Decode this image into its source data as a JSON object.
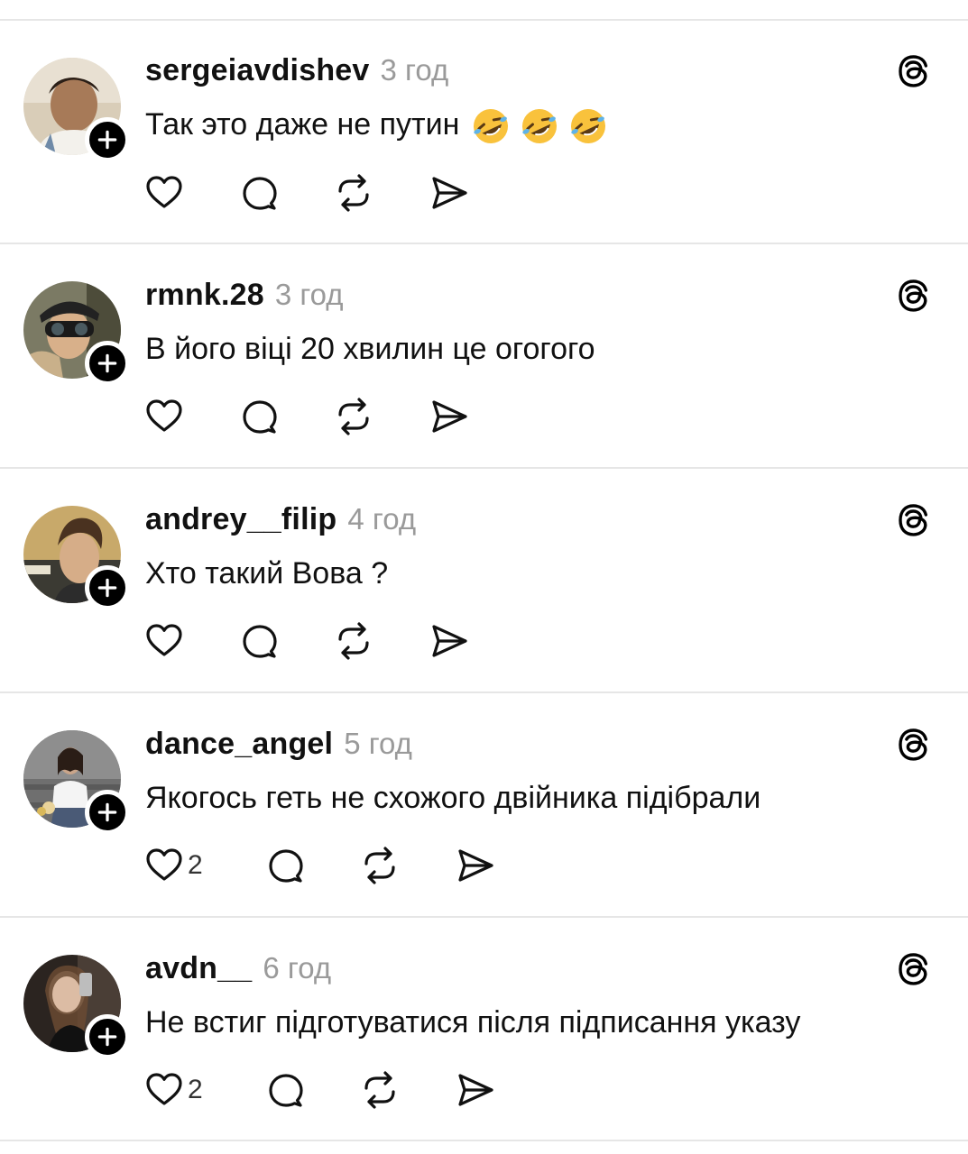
{
  "posts": [
    {
      "username": "sergeiavdishev",
      "time": "3 год",
      "text": "Так это даже не путин",
      "emojis": [
        "rolling-on-floor-laughing",
        "rolling-on-floor-laughing",
        "rolling-on-floor-laughing"
      ],
      "likes": "",
      "avatar_color": "#8a6a4a"
    },
    {
      "username": "rmnk.28",
      "time": "3 год",
      "text": "В його віці 20 хвилин це огогого",
      "emojis": [],
      "likes": "",
      "avatar_color": "#6b6a55"
    },
    {
      "username": "andrey__filip",
      "time": "4 год",
      "text": "Хто такий Вова ?",
      "emojis": [],
      "likes": "",
      "avatar_color": "#b79a66"
    },
    {
      "username": "dance_angel",
      "time": "5 год",
      "text": "Якогось геть не схожого двійника підібрали",
      "emojis": [],
      "likes": "2",
      "avatar_color": "#5a5a5a"
    },
    {
      "username": "avdn__",
      "time": "6 год",
      "text": "Не встиг підготуватися після підписання указу",
      "emojis": [],
      "likes": "2",
      "avatar_color": "#3a2e28"
    }
  ],
  "icons": {
    "like": "heart-icon",
    "reply": "reply-bubble-icon",
    "repost": "repost-icon",
    "share": "send-icon",
    "app": "threads-icon",
    "follow": "plus-icon"
  },
  "colors": {
    "text": "#111111",
    "muted": "#9a9a9a",
    "divider": "#e6e6e6",
    "badge": "#000000"
  }
}
